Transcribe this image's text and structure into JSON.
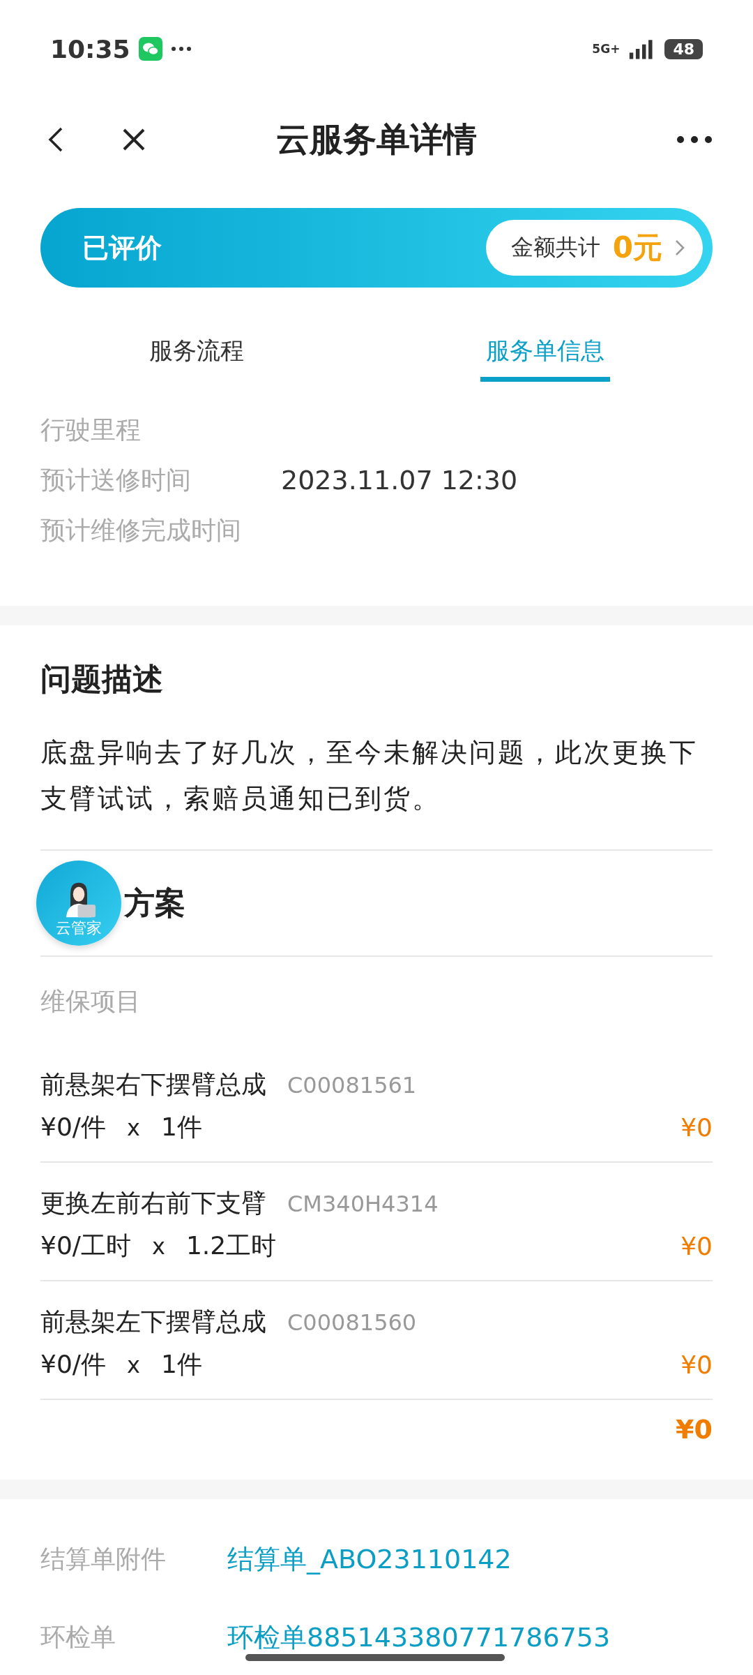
{
  "status_bar": {
    "time": "10:35",
    "network": "5G+",
    "battery": "48"
  },
  "header": {
    "title": "云服务单详情"
  },
  "banner": {
    "status": "已评价",
    "total_label": "金额共计",
    "total_value": "0元"
  },
  "tabs": [
    {
      "label": "服务流程",
      "selected": false
    },
    {
      "label": "服务单信息",
      "selected": true
    }
  ],
  "info_rows": [
    {
      "label": "行驶里程"
    },
    {
      "label": "预计送修时间",
      "value": "2023.11.07 12:30"
    },
    {
      "label": "预计维修完成时间"
    }
  ],
  "problem": {
    "title": "问题描述",
    "text": "底盘异响去了好几次，至今未解决问题，此次更换下支臂试试，索赔员通知已到货。"
  },
  "plan": {
    "title": "方案",
    "subtitle": "维保项目",
    "items": [
      {
        "name": "前悬架右下摆臂总成",
        "code": "C00081561",
        "unit_price": "¥0/件",
        "times": "x",
        "quantity": "1件",
        "amount": "¥0"
      },
      {
        "name": "更换左前右前下支臂",
        "code": "CM340H4314",
        "unit_price": "¥0/工时",
        "times": "x",
        "quantity": "1.2工时",
        "amount": "¥0"
      },
      {
        "name": "前悬架左下摆臂总成",
        "code": "C00081560",
        "unit_price": "¥0/件",
        "times": "x",
        "quantity": "1件",
        "amount": "¥0"
      }
    ],
    "total": "¥0"
  },
  "floating_assistant": {
    "label": "云管家"
  },
  "attachments": [
    {
      "label": "结算单附件",
      "link": "结算单_ABO23110142"
    },
    {
      "label": "环检单",
      "link": "环检单885143380771786753"
    }
  ]
}
